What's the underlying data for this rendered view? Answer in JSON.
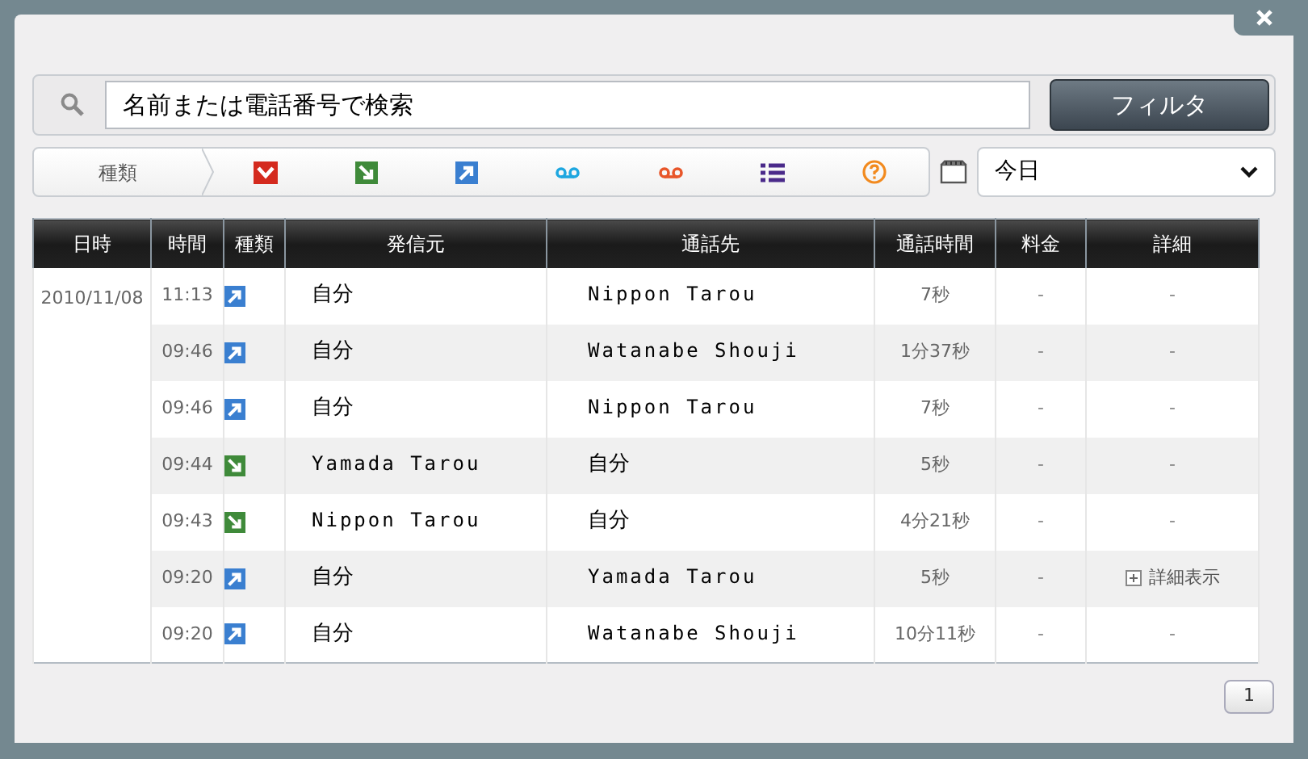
{
  "search": {
    "placeholder": "名前または電話番号で検索",
    "button": "フィルタ"
  },
  "type_filter": {
    "label": "種類"
  },
  "date_select": {
    "value": "今日"
  },
  "table": {
    "columns": [
      "日時",
      "時間",
      "種類",
      "発信元",
      "通話先",
      "通話時間",
      "料金",
      "詳細"
    ],
    "date": "2010/11/08",
    "rows": [
      {
        "time": "11:13",
        "kind": "outgoing",
        "from": "自分",
        "to": "Nippon Tarou",
        "duration": "7秒",
        "charge": "-",
        "detail": {
          "kind": "none",
          "text": "-"
        }
      },
      {
        "time": "09:46",
        "kind": "outgoing",
        "from": "自分",
        "to": "Watanabe Shouji",
        "duration": "1分37秒",
        "charge": "-",
        "detail": {
          "kind": "none",
          "text": "-"
        }
      },
      {
        "time": "09:46",
        "kind": "outgoing",
        "from": "自分",
        "to": "Nippon Tarou",
        "duration": "7秒",
        "charge": "-",
        "detail": {
          "kind": "none",
          "text": "-"
        }
      },
      {
        "time": "09:44",
        "kind": "incoming",
        "from": "Yamada Tarou",
        "to": "自分",
        "duration": "5秒",
        "charge": "-",
        "detail": {
          "kind": "none",
          "text": "-"
        }
      },
      {
        "time": "09:43",
        "kind": "incoming",
        "from": "Nippon Tarou",
        "to": "自分",
        "duration": "4分21秒",
        "charge": "-",
        "detail": {
          "kind": "none",
          "text": "-"
        }
      },
      {
        "time": "09:20",
        "kind": "outgoing",
        "from": "自分",
        "to": "Yamada Tarou",
        "duration": "5秒",
        "charge": "-",
        "detail": {
          "kind": "link",
          "text": "詳細表示"
        }
      },
      {
        "time": "09:20",
        "kind": "outgoing",
        "from": "自分",
        "to": "Watanabe Shouji",
        "duration": "10分11秒",
        "charge": "-",
        "detail": {
          "kind": "none",
          "text": "-"
        }
      }
    ]
  },
  "pagination": {
    "pages": [
      "1"
    ]
  }
}
